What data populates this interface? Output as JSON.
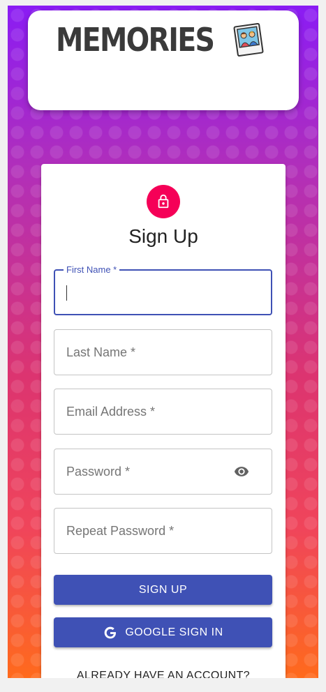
{
  "brand": {
    "title": "MEMORIES",
    "icon": "photo-memories-icon"
  },
  "auth": {
    "avatar_icon": "lock-icon",
    "heading": "Sign Up",
    "fields": {
      "first_name": {
        "label": "First Name *",
        "value": ""
      },
      "last_name": {
        "placeholder": "Last Name *"
      },
      "email": {
        "placeholder": "Email Address *"
      },
      "password": {
        "placeholder": "Password *",
        "toggle_icon": "eye-icon"
      },
      "repeat_password": {
        "placeholder": "Repeat Password *"
      }
    },
    "submit_label": "SIGN UP",
    "google_label": "GOOGLE SIGN IN",
    "switch_label": "ALREADY HAVE AN ACCOUNT?"
  },
  "colors": {
    "primary": "#3f51b5",
    "avatar": "#f50057",
    "focus": "#3f51b5"
  }
}
